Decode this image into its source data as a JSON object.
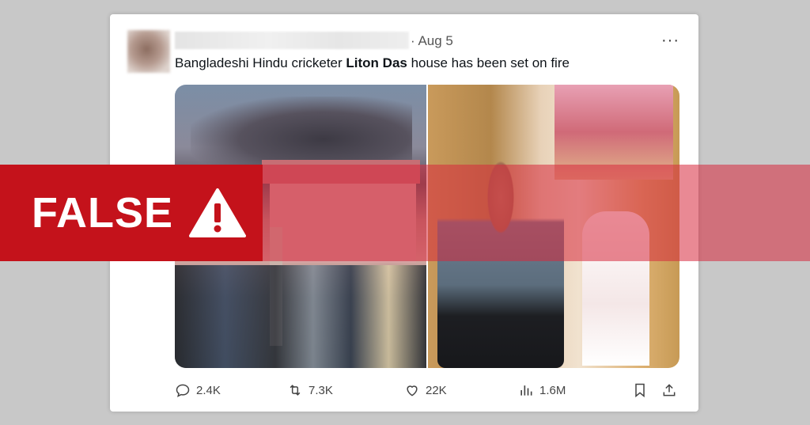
{
  "post": {
    "date": "Aug 5",
    "more_icon": "···",
    "text_prefix": "Bangladeshi Hindu cricketer ",
    "text_bold": "Liton Das",
    "text_suffix": " house has been set on fire"
  },
  "actions": {
    "replies": "2.4K",
    "reposts": "7.3K",
    "likes": "22K",
    "views": "1.6M"
  },
  "overlay": {
    "label": "FALSE",
    "banner_color": "#c4121b",
    "strip_color": "#d7283c"
  },
  "icons": [
    "reply-icon",
    "repost-icon",
    "like-icon",
    "views-icon",
    "bookmark-icon",
    "share-icon",
    "warning-icon"
  ]
}
